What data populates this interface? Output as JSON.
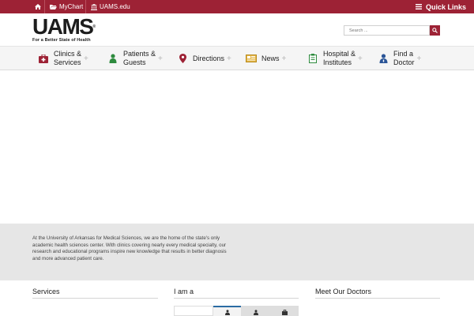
{
  "topbar": {
    "home_icon": "home-icon",
    "mychart_label": "MyChart",
    "mychart_icon": "folder-open-icon",
    "uams_edu_label": "UAMS.edu",
    "uams_edu_icon": "institution-icon",
    "quick_links_label": "Quick Links",
    "quick_links_icon": "menu-bars-icon"
  },
  "brand": {
    "logo_text": "UAMS",
    "trademark": "®",
    "tagline": "For a Better State of Health",
    "color": "#9d2235"
  },
  "search": {
    "placeholder": "Search ...",
    "button_icon": "search-icon"
  },
  "nav": [
    {
      "line1": "Clinics &",
      "line2": "Services",
      "icon": "first-aid-kit-icon"
    },
    {
      "line1": "Patients &",
      "line2": "Guests",
      "icon": "person-icon"
    },
    {
      "line1": "Directions",
      "line2": "",
      "icon": "map-marker-icon"
    },
    {
      "line1": "News",
      "line2": "",
      "icon": "newspaper-icon"
    },
    {
      "line1": "Hospital &",
      "line2": "Institutes",
      "icon": "clipboard-icon"
    },
    {
      "line1": "Find a",
      "line2": "Doctor",
      "icon": "doctor-icon"
    }
  ],
  "about": {
    "text": "At the University of Arkansas for Medical Sciences, we are the home of the state's only academic health sciences center. With clinics covering nearly every medical specialty, our research and educational programs inspire new knowledge that results in better diagnosis and more advanced patient care."
  },
  "columns": {
    "services": "Services",
    "i_am_a": "I am a",
    "meet_doctors": "Meet Our Doctors"
  },
  "i_am_a_tabs": [
    "blank-tab",
    "person-icon",
    "person-icon",
    "briefcase-icon"
  ]
}
